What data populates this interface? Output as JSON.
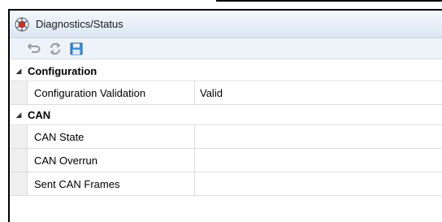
{
  "window": {
    "title": "Diagnostics/Status"
  },
  "toolbar": {
    "buttons": [
      {
        "icon": "undo-arrow-icon"
      },
      {
        "icon": "refresh-icon"
      },
      {
        "icon": "save-disk-icon"
      }
    ]
  },
  "grid": {
    "categories": [
      {
        "label": "Configuration",
        "rows": [
          {
            "name": "Configuration Validation",
            "value": "Valid"
          }
        ]
      },
      {
        "label": "CAN",
        "rows": [
          {
            "name": "CAN State",
            "value": ""
          },
          {
            "name": "CAN Overrun",
            "value": ""
          },
          {
            "name": "Sent CAN Frames",
            "value": ""
          }
        ]
      }
    ]
  },
  "colors": {
    "accent": "#2f6fb3",
    "icon_red": "#c8321f"
  }
}
